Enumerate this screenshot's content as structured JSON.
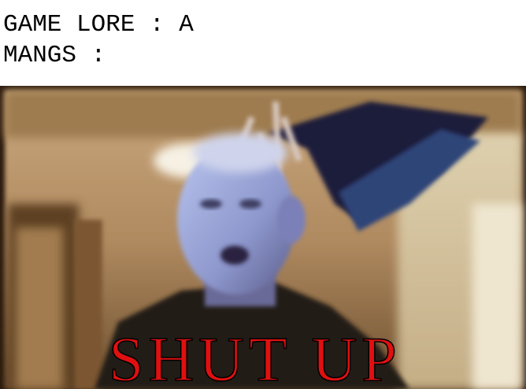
{
  "caption": {
    "line1": "GAME LORE : A",
    "line2": "MANGS :"
  },
  "overlay_text": "SHUT UP",
  "colors": {
    "overlay_text": "#e01010",
    "background": "#ffffff"
  }
}
